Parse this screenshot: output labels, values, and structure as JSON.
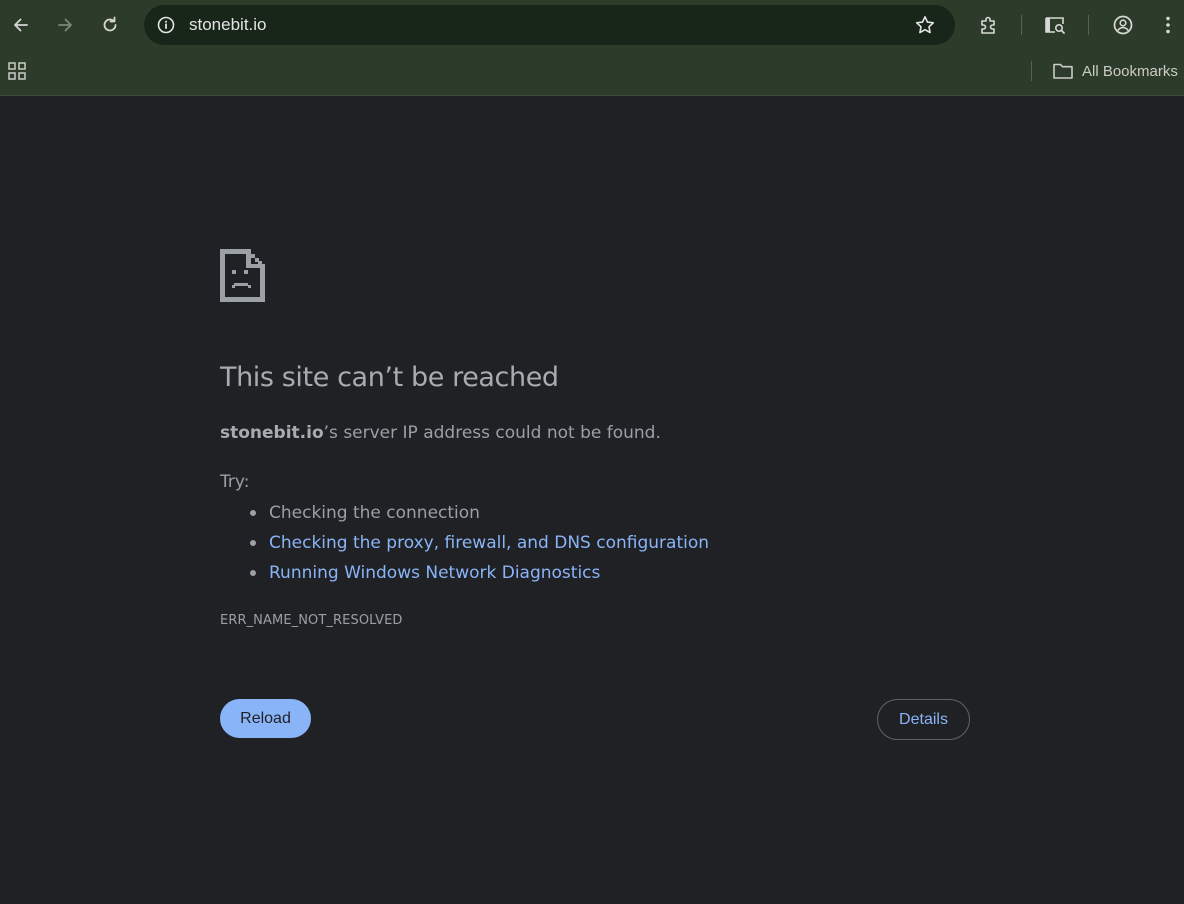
{
  "toolbar": {
    "back_icon": "arrow-left-icon",
    "forward_icon": "arrow-right-icon",
    "reload_icon": "reload-icon",
    "url": "stonebit.io",
    "site_info_icon": "info-icon",
    "bookmark_icon": "star-icon",
    "extensions_icon": "puzzle-icon",
    "tab_search_icon": "tab-search-icon",
    "profile_icon": "profile-icon",
    "menu_icon": "kebab-menu-icon"
  },
  "bookmarks_bar": {
    "apps_icon": "apps-grid-icon",
    "all_bookmarks_label": "All Bookmarks",
    "folder_icon": "folder-icon"
  },
  "error_page": {
    "title": "This site can’t be reached",
    "summary_host": "stonebit.io",
    "summary_text": "’s server IP address could not be found.",
    "try_label": "Try:",
    "suggestions": [
      {
        "text": "Checking the connection",
        "is_link": false
      },
      {
        "text": "Checking the proxy, firewall, and DNS configuration",
        "is_link": true
      },
      {
        "text": "Running Windows Network Diagnostics",
        "is_link": true
      }
    ],
    "error_code": "ERR_NAME_NOT_RESOLVED",
    "reload_label": "Reload",
    "details_label": "Details"
  },
  "colors": {
    "page_bg": "#202124",
    "toolbar_bg": "#2d3c2a",
    "omnibox_bg": "#18261a",
    "link": "#8ab4f8",
    "text": "#9aa0a6"
  }
}
